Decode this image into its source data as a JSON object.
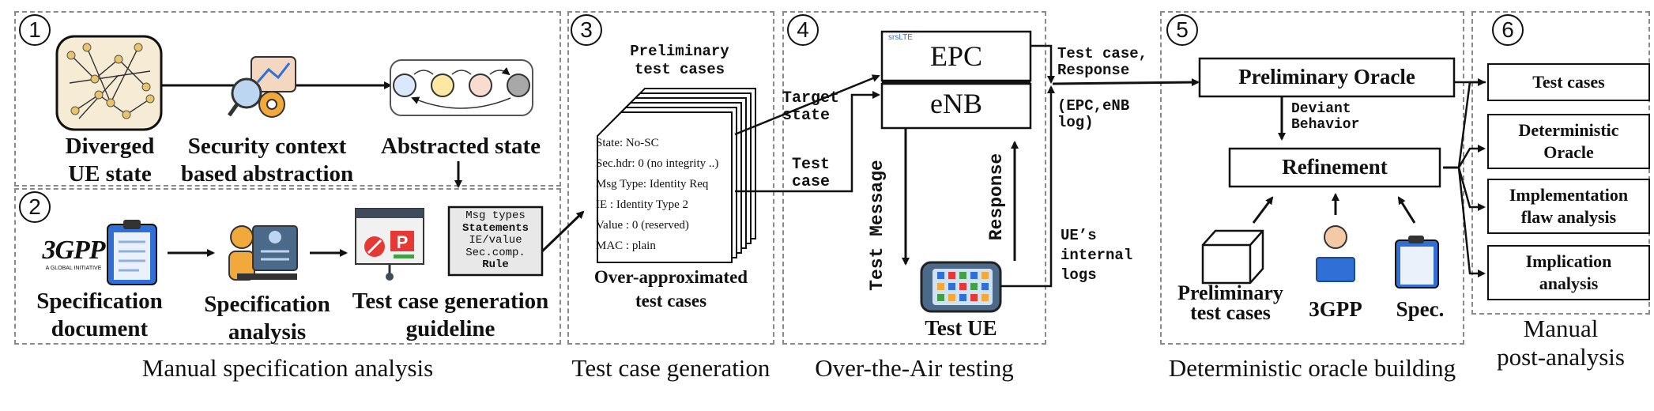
{
  "panels": {
    "p1": {
      "num": "1",
      "diverged": "Diverged\nUE state",
      "security": "Security context\nbased abstraction",
      "abstracted": "Abstracted state"
    },
    "p2": {
      "num": "2",
      "spec_doc": "Specification\ndocument",
      "spec_analysis": "Specification\nanalysis",
      "guideline": "Test case generation\nguideline",
      "rule_lines": [
        "Msg types",
        "Statements",
        "IE/value",
        "Sec.comp.",
        "Rule"
      ],
      "logo_3gpp": "3GPP",
      "logo_tagline": "A GLOBAL INITIATIVE"
    },
    "p3": {
      "num": "3",
      "prelim": "Preliminary\ntest cases",
      "card_lines": [
        "State: No-SC",
        "Sec.hdr: 0 (no integrity ..)",
        "Msg Type: Identity Req",
        "IE : Identity Type 2",
        "Value : 0 (reserved)",
        "MAC : plain"
      ],
      "over_approx": "Over-approximated\ntest cases"
    },
    "p4": {
      "num": "4",
      "epc": "EPC",
      "enb": "eNB",
      "srslte": "srsLTE",
      "target_state": "Target\nstate",
      "test_case": "Test\ncase",
      "test_message": "Test Message",
      "response": "Response",
      "test_ue": "Test UE",
      "tc_response": "Test case,\nResponse",
      "epc_log": "(EPC,eNB\nlog)",
      "ue_logs": "UE’s\ninternal\nlogs"
    },
    "p5": {
      "num": "5",
      "prelim_oracle": "Preliminary Oracle",
      "deviant": "Deviant\nBehavior",
      "refinement": "Refinement",
      "prelim_tc": "Preliminary\ntest cases",
      "gpp": "3GPP",
      "spec": "Spec."
    },
    "p6": {
      "num": "6",
      "items": [
        "Test cases",
        "Deterministic\nOracle",
        "Implementation\nflaw analysis",
        "Implication\nanalysis"
      ]
    }
  },
  "captions": [
    "Manual specification analysis",
    "Test case generation",
    "Over-the-Air testing",
    "Deterministic oracle building",
    "Manual\npost-analysis"
  ],
  "colors": {
    "state1": "#dbe7fb",
    "state2": "#fde8a1",
    "state3": "#f9dcd0",
    "state4": "#a8a8a8",
    "accent_blue": "#2f6fd6",
    "phone": "#4b6a8a"
  }
}
